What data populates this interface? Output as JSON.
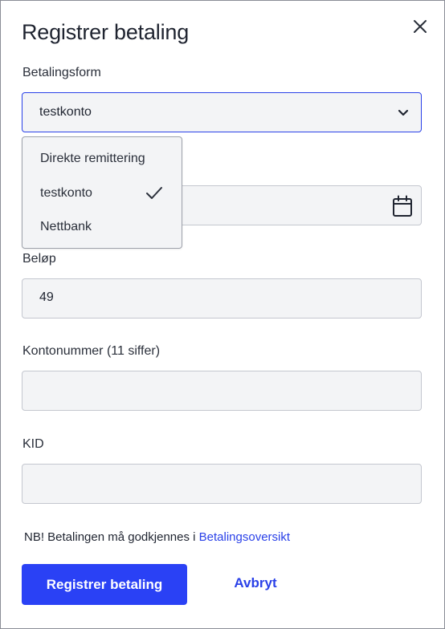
{
  "dialog": {
    "title": "Registrer betaling",
    "close_icon": "close-icon"
  },
  "payment_method": {
    "label": "Betalingsform",
    "selected": "testkonto",
    "options": [
      "Direkte remittering",
      "testkonto",
      "Nettbank"
    ],
    "checked_option": "testkonto"
  },
  "date": {
    "value": "",
    "icon": "calendar-icon"
  },
  "amount": {
    "label": "Beløp",
    "value": "49"
  },
  "account_number": {
    "label": "Kontonummer (11 siffer)",
    "value": ""
  },
  "kid": {
    "label": "KID",
    "value": ""
  },
  "note": {
    "text": "NB! Betalingen må godkjennes i ",
    "link": "Betalingsoversikt"
  },
  "actions": {
    "submit_label": "Registrer betaling",
    "cancel_label": "Avbryt"
  },
  "colors": {
    "accent": "#2a41f5",
    "field_bg": "#f3f4f6",
    "field_border": "#c4c7cf",
    "text": "#1f2430"
  }
}
